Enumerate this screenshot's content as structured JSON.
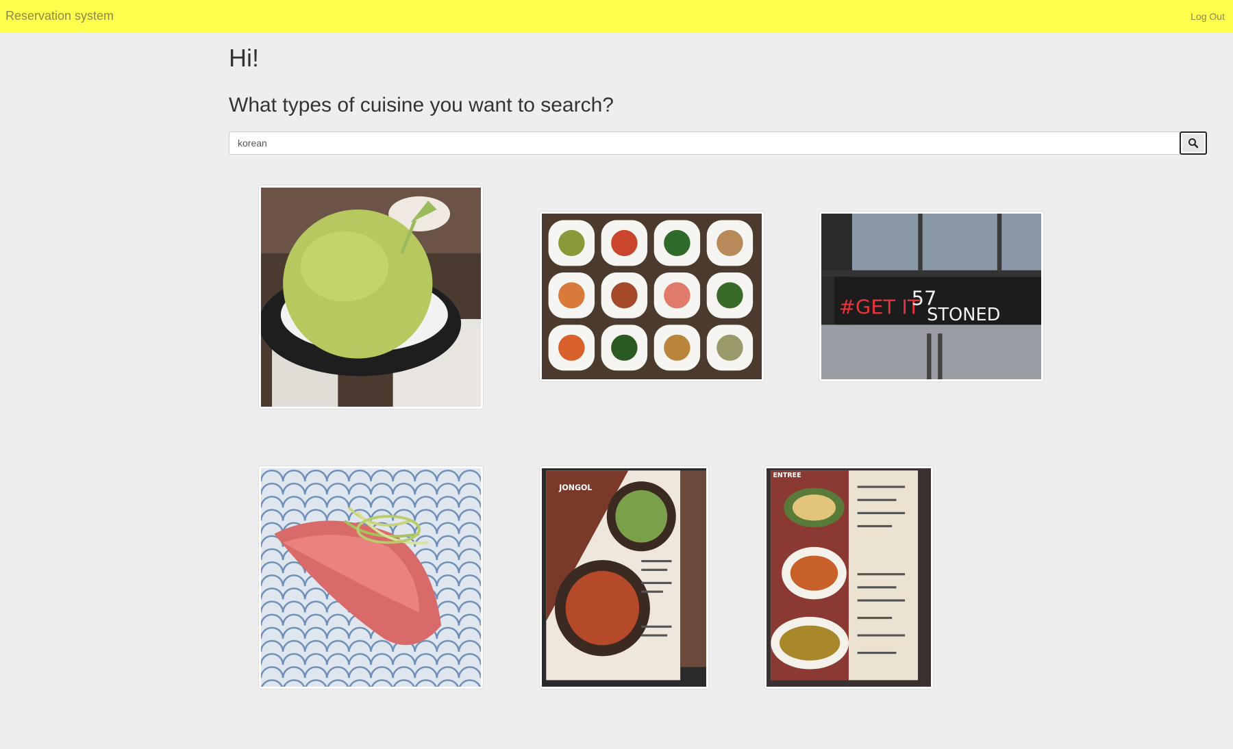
{
  "navbar": {
    "brand": "Reservation system",
    "logout_label": "Log Out"
  },
  "main": {
    "greeting": "Hi!",
    "question": "What types of cuisine you want to search?",
    "search": {
      "value": "korean",
      "button_icon": "search-icon"
    }
  },
  "results": [
    {
      "name": "melon-bingsu-photo"
    },
    {
      "name": "banchan-side-dishes-photo"
    },
    {
      "name": "get-it-stoned-storefront-photo"
    },
    {
      "name": "seared-fish-sushi-photo"
    },
    {
      "name": "jongol-menu-page-photo"
    },
    {
      "name": "entree-menu-page-photo"
    }
  ],
  "storefront_sign": {
    "hashtag": "#GET IT",
    "number": "57",
    "word": "STONED"
  },
  "menu_page_left": {
    "header": "JONGOL"
  },
  "menu_page_right": {
    "header": "ENTREE"
  },
  "colors": {
    "navbar": "#ffff4d",
    "page_background": "#eeeeee",
    "neon_red": "#e8343c"
  }
}
